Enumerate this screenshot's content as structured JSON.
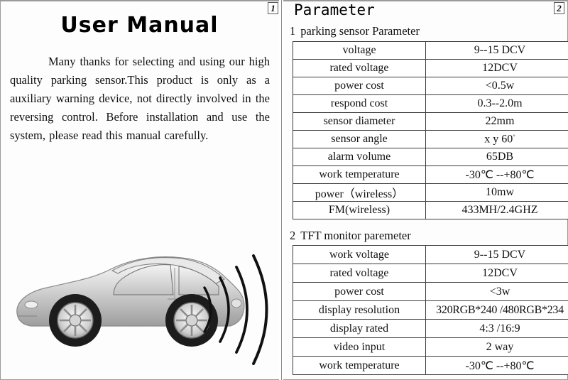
{
  "left_page": {
    "page_number": "1",
    "title": "User  Manual",
    "body": "Many  thanks for selecting and  using our high quality parking sensor.This product is only as a auxiliary warning device, not directly involved in the reversing control.    Before installation and use the system, please read this manual carefully.",
    "illustration": {
      "name": "car-reversing-sensor-illustration",
      "arc_count": 4,
      "car_color": "#b9b9b9"
    }
  },
  "right_page": {
    "page_number": "2",
    "title": "Parameter",
    "sections": [
      {
        "number": "1",
        "heading": "parking sensor Parameter",
        "rows": [
          {
            "label": "voltage",
            "value": "9--15 DCV"
          },
          {
            "label": "rated voltage",
            "value": "12DCV"
          },
          {
            "label": "power cost",
            "value": "<0.5w"
          },
          {
            "label": "respond cost",
            "value": "0.3--2.0m"
          },
          {
            "label": "sensor diameter",
            "value": "22mm"
          },
          {
            "label": "sensor angle",
            "value": "x  y  60"
          },
          {
            "label": "alarm volume",
            "value": "65DB"
          },
          {
            "label": "work temperature",
            "value": "-30℃ --+80℃"
          },
          {
            "label": "power（wireless）",
            "value": "10mw"
          },
          {
            "label": "FM(wireless)",
            "value": "433MH/2.4GHZ"
          }
        ]
      },
      {
        "number": "2",
        "heading": "TFT  monitor  paremeter",
        "rows": [
          {
            "label": "work   voltage",
            "value": "9--15 DCV"
          },
          {
            "label": "rated   voltage",
            "value": "12DCV"
          },
          {
            "label": "power   cost",
            "value": "<3w"
          },
          {
            "label": "display resolution",
            "value": "320RGB*240 /480RGB*234"
          },
          {
            "label": "display rated",
            "value": "4:3 /16:9"
          },
          {
            "label": "video  input",
            "value": "2  way"
          },
          {
            "label": "work   temperature",
            "value": "-30℃ --+80℃"
          }
        ]
      }
    ]
  }
}
